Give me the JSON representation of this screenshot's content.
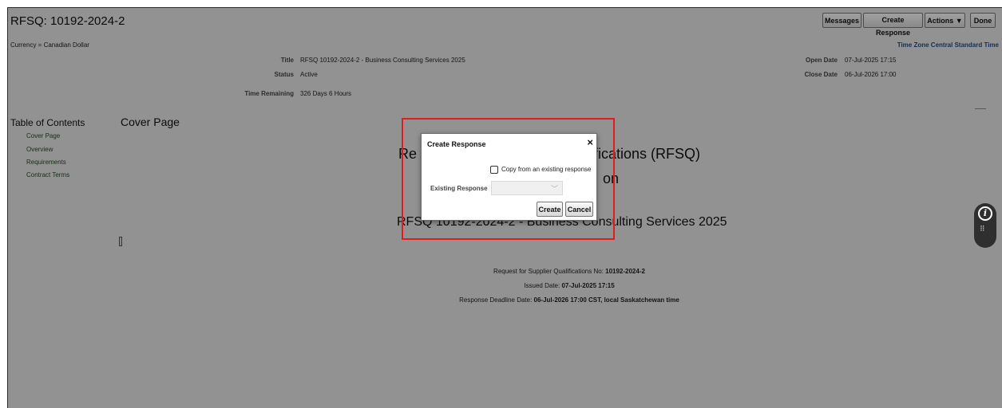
{
  "header": {
    "title": "RFSQ: 10192-2024-2",
    "buttons": {
      "messages": "Messages",
      "create_response": "Create Response",
      "actions": "Actions ▼",
      "done": "Done"
    }
  },
  "summary": {
    "currency": "Currency = Canadian Dollar",
    "time_zone": "Time Zone Central Standard Time",
    "title_label": "Title",
    "title_value": "RFSQ 10192-2024-2 - Business Consulting Services 2025",
    "status_label": "Status",
    "status_value": "Active",
    "time_remaining_label": "Time Remaining",
    "time_remaining_value": "326 Days 6 Hours",
    "open_date_label": "Open Date",
    "open_date_value": "07-Jul-2025 17:15",
    "close_date_label": "Close Date",
    "close_date_value": "06-Jul-2026 17:00"
  },
  "toc": {
    "heading": "Table of Contents",
    "items": [
      "Cover Page",
      "Overview",
      "Requirements",
      "Contract Terms"
    ]
  },
  "cover": {
    "heading": "Cover Page",
    "big_line1_left": "Re",
    "big_line1_right": "ifications (RFSQ)",
    "big_line2_right": "on",
    "big_line3": "RFSQ 10192-2024-2 - Business Consulting Services 2025",
    "detail_no_label": "Request for Supplier Qualifications No: ",
    "detail_no_value": "10192-2024-2",
    "issued_label": "Issued Date: ",
    "issued_value": "07-Jul-2025 17:15",
    "deadline_label": "Response Deadline Date: ",
    "deadline_value": "06-Jul-2026 17:00 CST, local Saskatchewan time"
  },
  "dialog": {
    "title": "Create Response",
    "close_glyph": "×",
    "copy_checkbox_label": "Copy from an existing response",
    "existing_response_label": "Existing Response",
    "existing_response_value": "",
    "create_button": "Create",
    "cancel_button": "Cancel"
  },
  "help_widget": {
    "info_glyph": "i",
    "menu_glyph": "⠿"
  },
  "colors": {
    "highlight_box": "#e31b1b",
    "link_green": "#214d22",
    "time_zone_blue": "#1f4d80"
  }
}
